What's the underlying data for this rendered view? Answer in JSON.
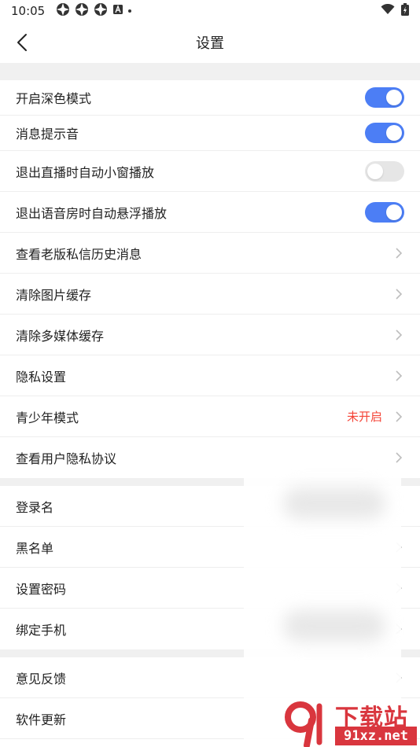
{
  "status": {
    "time": "10:05"
  },
  "header": {
    "title": "设置"
  },
  "group1": [
    {
      "label": "开启深色模式",
      "toggle": "on"
    },
    {
      "label": "消息提示音",
      "toggle": "on"
    },
    {
      "label": "退出直播时自动小窗播放",
      "toggle": "off"
    },
    {
      "label": "退出语音房时自动悬浮播放",
      "toggle": "on"
    },
    {
      "label": "查看老版私信历史消息"
    },
    {
      "label": "清除图片缓存"
    },
    {
      "label": "清除多媒体缓存"
    },
    {
      "label": "隐私设置"
    },
    {
      "label": "青少年模式",
      "value": "未开启"
    },
    {
      "label": "查看用户隐私协议"
    }
  ],
  "group2": [
    {
      "label": "登录名"
    },
    {
      "label": "黑名单"
    },
    {
      "label": "设置密码"
    },
    {
      "label": "绑定手机"
    }
  ],
  "group3": [
    {
      "label": "意见反馈"
    },
    {
      "label": "软件更新"
    }
  ],
  "watermark": {
    "brand": "下载站",
    "site": "91xz.net"
  },
  "colors": {
    "accent": "#4c7ef5",
    "warning": "#f44336",
    "watermark": "#d9363e"
  }
}
